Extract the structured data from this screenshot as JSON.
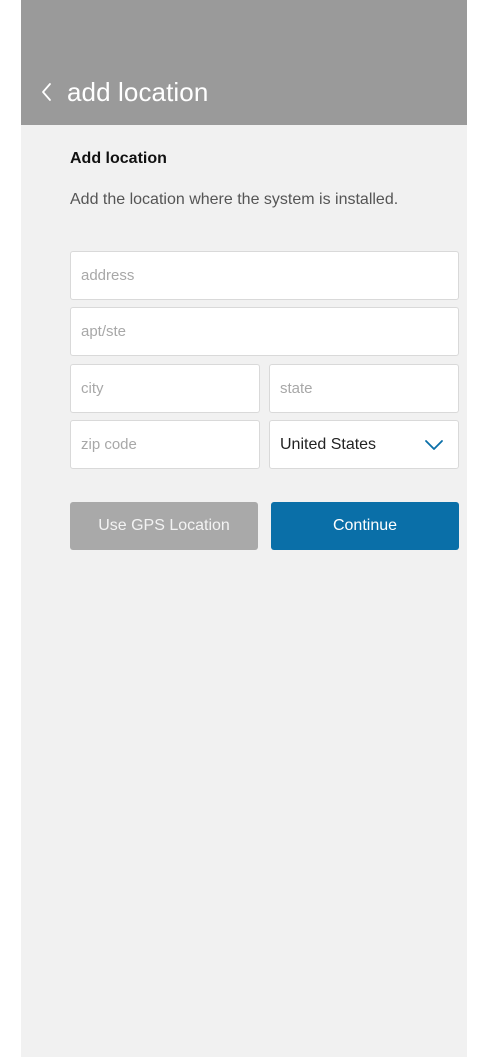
{
  "header": {
    "title": "add location",
    "back_icon": "chevron-left-icon",
    "background": "#9a9a9a"
  },
  "section": {
    "title": "Add location",
    "subtitle": "Add the location where the system is installed."
  },
  "form": {
    "address": {
      "placeholder": "address",
      "value": ""
    },
    "apt": {
      "placeholder": "apt/ste",
      "value": ""
    },
    "city": {
      "placeholder": "city",
      "value": ""
    },
    "state": {
      "placeholder": "state",
      "value": ""
    },
    "zip": {
      "placeholder": "zip code",
      "value": ""
    },
    "country": {
      "selected": "United States",
      "icon": "chevron-down-icon",
      "accent": "#0a6fa8"
    }
  },
  "buttons": {
    "gps_label": "Use GPS Location",
    "continue_label": "Continue",
    "continue_color": "#0a6fa8",
    "gps_color": "#a9a9a9"
  }
}
